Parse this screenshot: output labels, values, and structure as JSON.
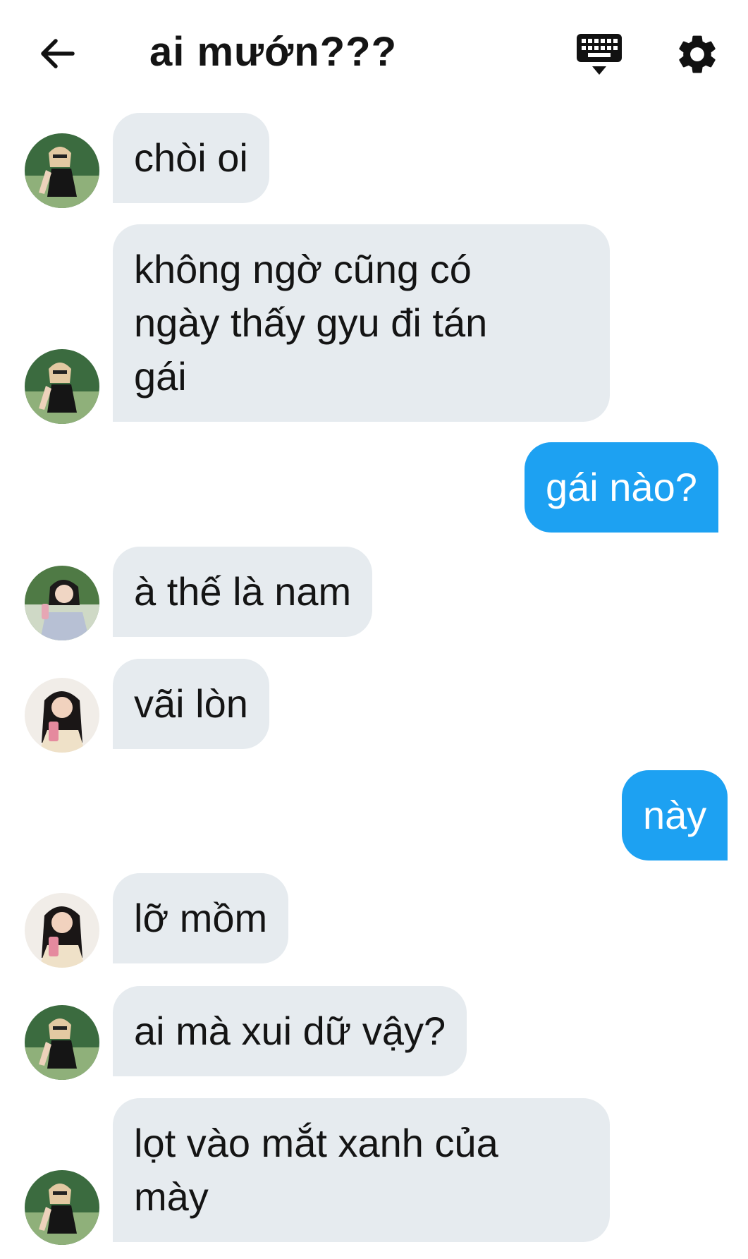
{
  "header": {
    "title": "ai mướn???",
    "back_icon": "arrow-left-icon",
    "keyboard_icon": "keyboard-icon",
    "settings_icon": "gear-icon"
  },
  "colors": {
    "incoming_bubble": "#e6ebef",
    "outgoing_bubble": "#1da1f2",
    "background": "#ffffff"
  },
  "messages": [
    {
      "dir": "in",
      "avatar": "avatar-rose-black-top",
      "text": "chòi oi"
    },
    {
      "dir": "in",
      "avatar": "avatar-rose-black-top",
      "lines": [
        "không ngờ cũng có",
        "ngày thấy gyu đi tán",
        "gái"
      ]
    },
    {
      "dir": "out",
      "text": "gái nào?"
    },
    {
      "dir": "in",
      "avatar": "avatar-short-hair-drink",
      "text": "à thế là nam"
    },
    {
      "dir": "in",
      "avatar": "avatar-jennie-pink-drink",
      "text": "vãi lòn"
    },
    {
      "dir": "out",
      "text": "này"
    },
    {
      "dir": "in",
      "avatar": "avatar-jennie-pink-drink",
      "text": "lỡ mồm"
    },
    {
      "dir": "in",
      "avatar": "avatar-rose-black-top",
      "text": "ai mà xui dữ vậy?"
    },
    {
      "dir": "in",
      "avatar": "avatar-rose-black-top",
      "lines": [
        "lọt vào mắt xanh của",
        "mày"
      ]
    }
  ]
}
